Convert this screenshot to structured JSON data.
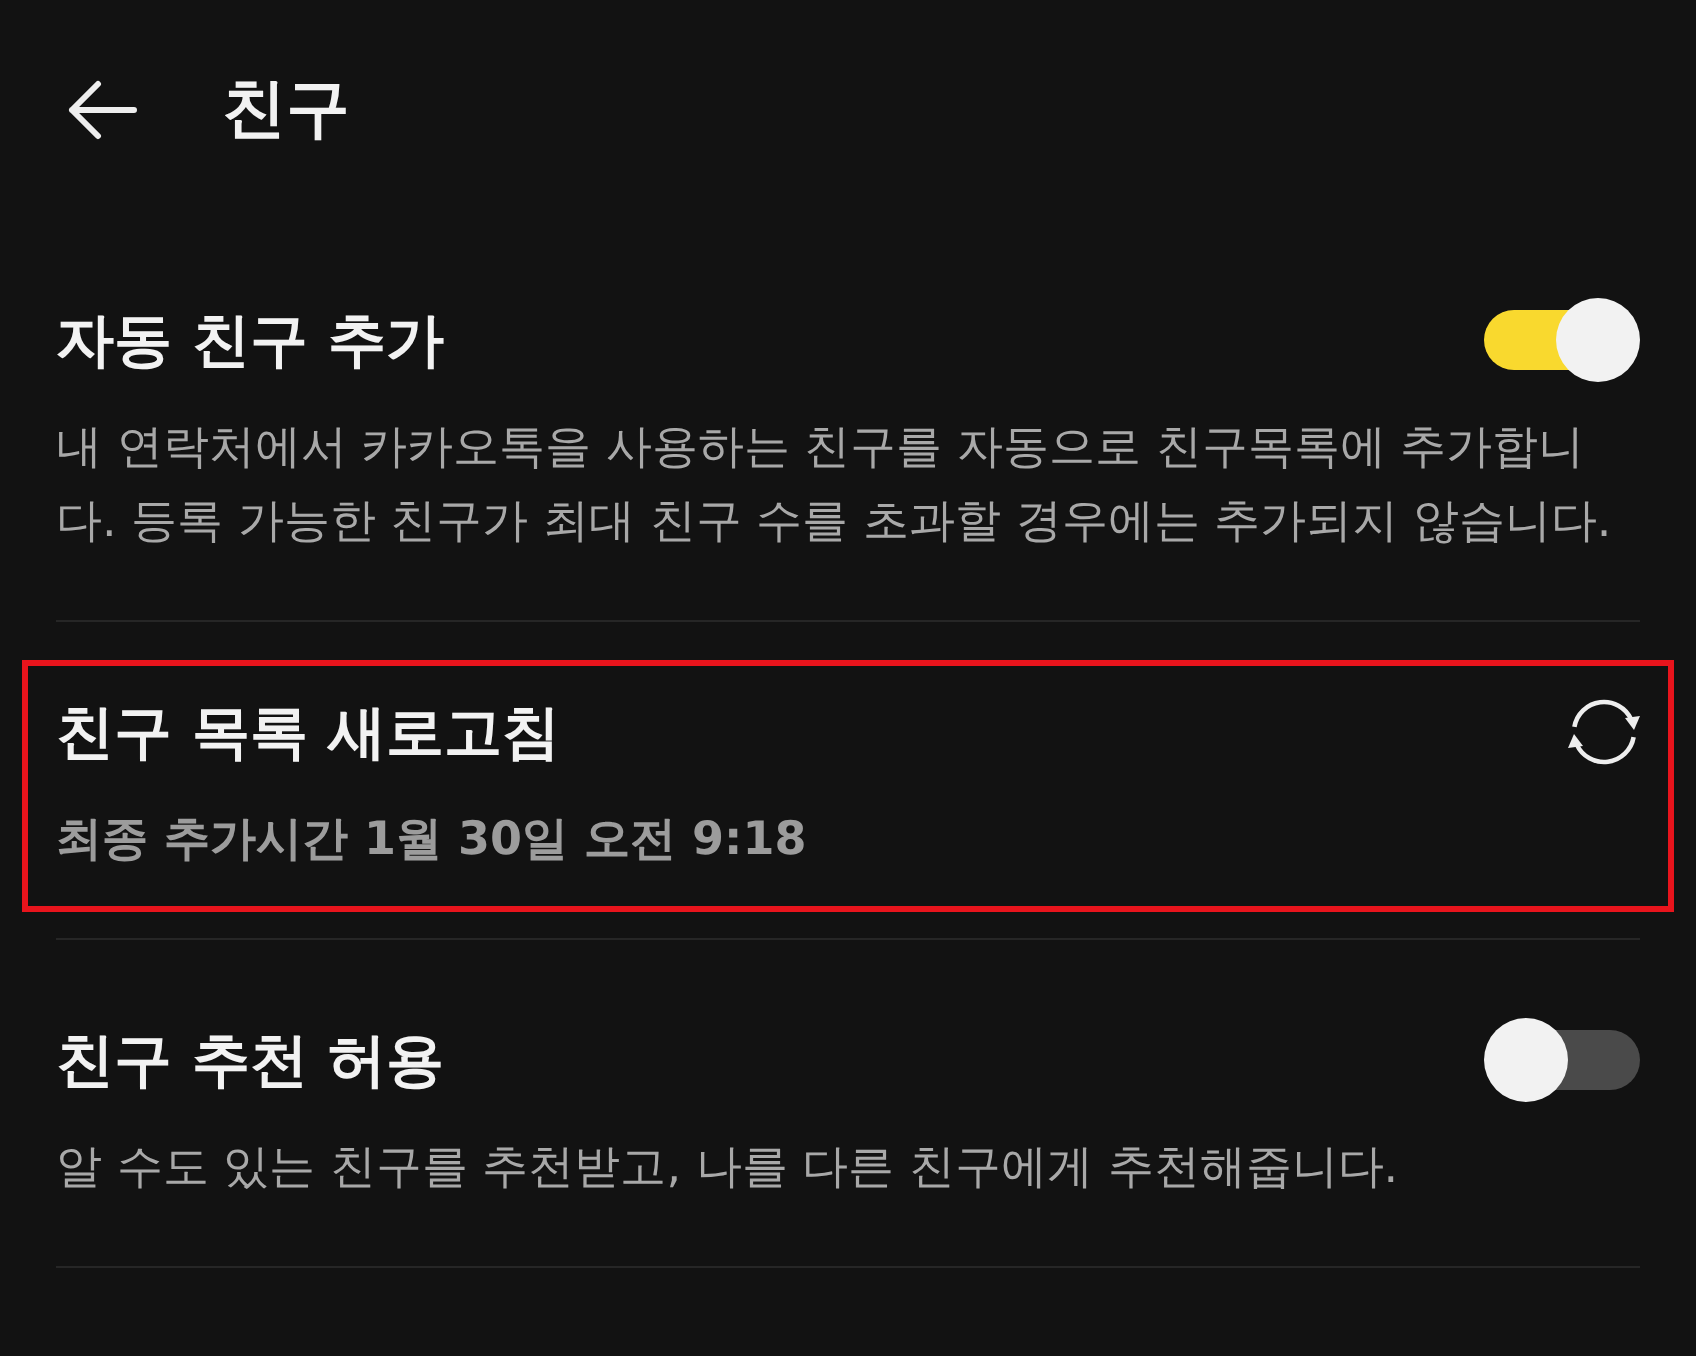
{
  "header": {
    "title": "친구"
  },
  "settings": [
    {
      "kind": "toggle",
      "title": "자동 친구 추가",
      "description": "내 연락처에서 카카오톡을 사용하는 친구를 자동으로 친구목록에 추가합니다. 등록 가능한 친구가 최대 친구 수를 초과할 경우에는 추가되지 않습니다.",
      "on": true,
      "highlighted": false
    },
    {
      "kind": "refresh",
      "title": "친구 목록 새로고침",
      "description": "최종 추가시간 1월 30일 오전 9:18",
      "highlighted": true
    },
    {
      "kind": "toggle",
      "title": "친구 추천 허용",
      "description": "알 수도 있는 친구를 추천받고, 나를 다른 친구에게 추천해줍니다.",
      "on": false,
      "highlighted": false
    }
  ]
}
